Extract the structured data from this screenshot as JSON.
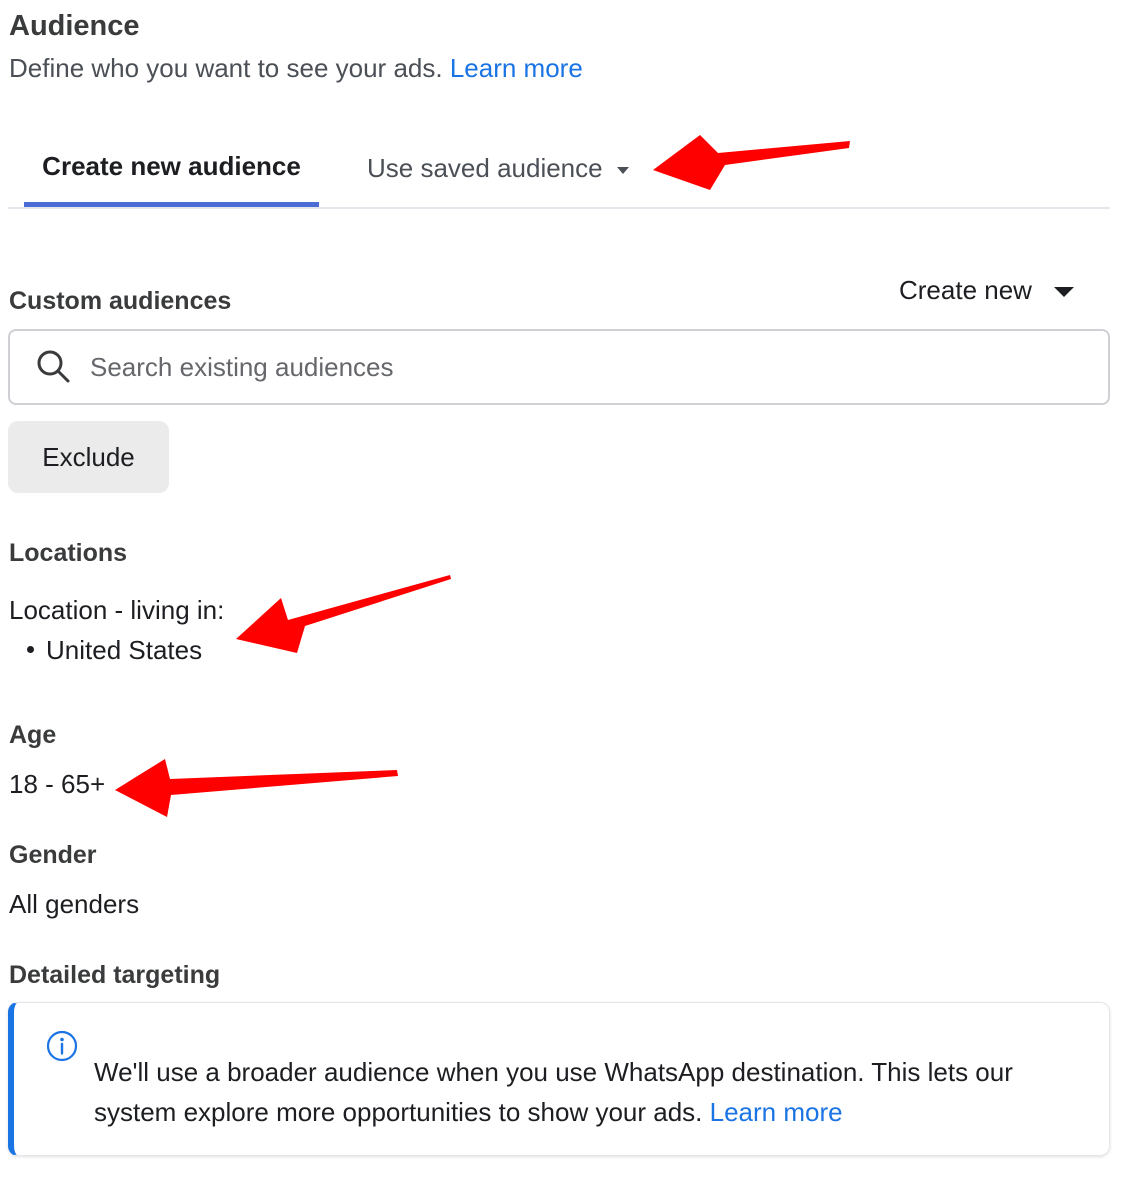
{
  "header": {
    "title": "Audience",
    "description": "Define who you want to see your ads.",
    "learn_more": "Learn more"
  },
  "tabs": [
    {
      "label": "Create new audience",
      "active": true
    },
    {
      "label": "Use saved audience",
      "active": false
    }
  ],
  "custom_audiences": {
    "label": "Custom audiences",
    "create_new": "Create new",
    "search_placeholder": "Search existing audiences",
    "exclude": "Exclude"
  },
  "locations": {
    "label": "Locations",
    "type": "Location - living in:",
    "items": [
      "United States"
    ]
  },
  "age": {
    "label": "Age",
    "value": "18 - 65+"
  },
  "gender": {
    "label": "Gender",
    "value": "All genders"
  },
  "detailed_targeting": {
    "label": "Detailed targeting",
    "notice": "We'll use a broader audience when you use WhatsApp destination. This lets our system explore more opportunities to show your ads.",
    "learn_more": "Learn more"
  },
  "colors": {
    "link": "#1b74e4",
    "tab_underline": "#4a6cd4",
    "annotation_arrow": "#ff0000"
  },
  "icons": [
    "search-icon",
    "info-icon",
    "caret-down-icon"
  ]
}
